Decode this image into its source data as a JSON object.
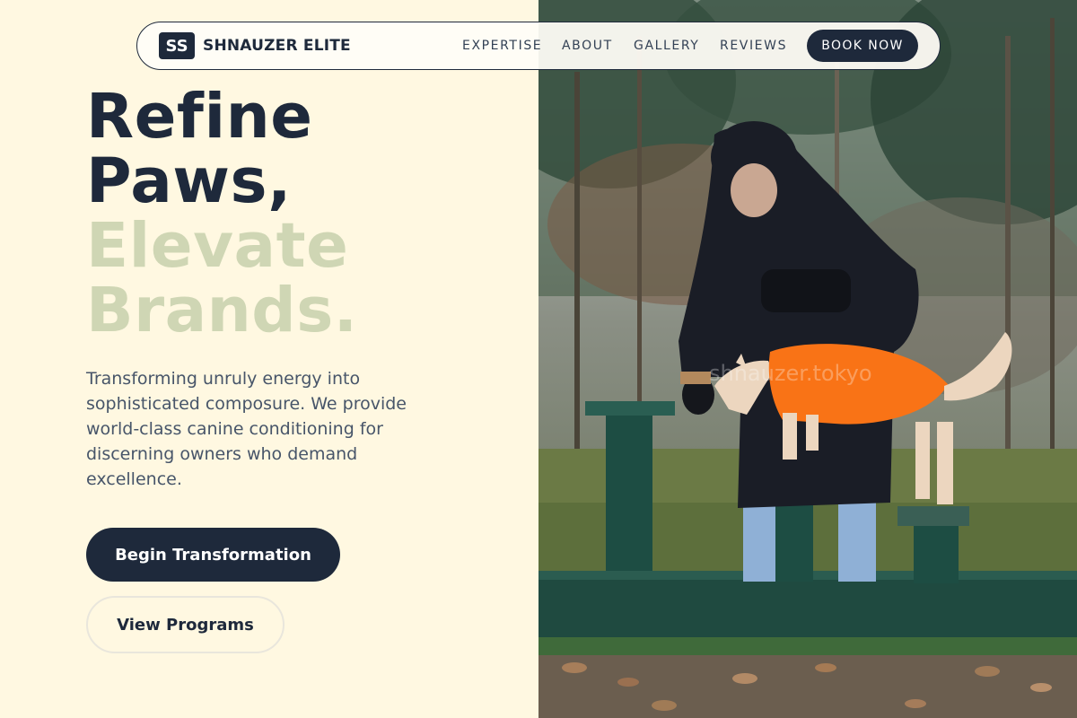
{
  "brand": {
    "mark": "SS",
    "name": "SHNAUZER ELITE"
  },
  "nav": {
    "links": [
      "EXPERTISE",
      "ABOUT",
      "GALLERY",
      "REVIEWS"
    ],
    "cta_label": "BOOK NOW"
  },
  "hero": {
    "headline_dark": [
      "Refine",
      "Paws,"
    ],
    "headline_light": [
      "Elevate",
      "Brands."
    ],
    "description": "Transforming unruly energy into sophisticated composure. We provide world-class canine conditioning for discerning owners who demand excellence.",
    "primary_button": "Begin Transformation",
    "secondary_button": "View Programs"
  },
  "photo": {
    "watermark": "shnauzer.tokyo"
  },
  "colors": {
    "dark": "#1e293b",
    "cream": "#fff8e1",
    "sage": "#cfd6b4",
    "body_text": "#475569",
    "dog_coat": "#f97316"
  }
}
